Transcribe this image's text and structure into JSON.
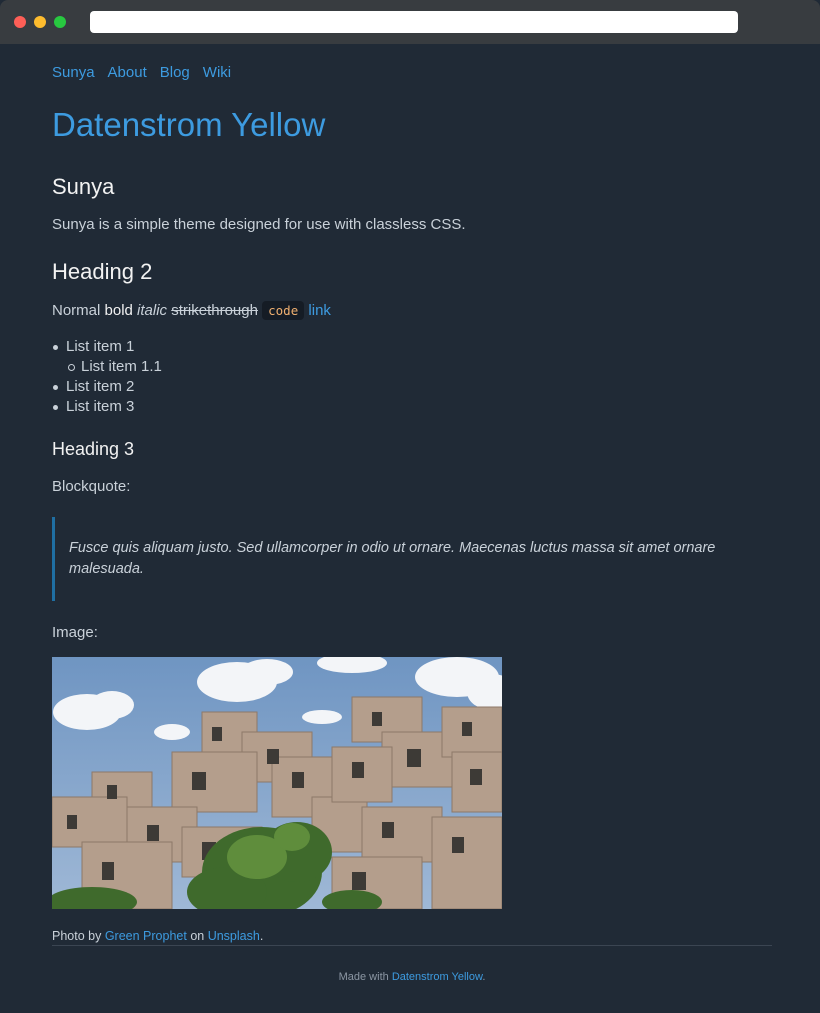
{
  "browser": {
    "url": ""
  },
  "nav": {
    "items": [
      "Sunya",
      "About",
      "Blog",
      "Wiki"
    ]
  },
  "site_title": "Datenstrom Yellow",
  "content": {
    "h1": "Sunya",
    "intro": "Sunya is a simple theme designed for use with classless CSS.",
    "h2": "Heading 2",
    "inline": {
      "normal": "Normal",
      "bold": "bold",
      "italic": "italic",
      "strike": "strikethrough",
      "code": "code",
      "link": "link"
    },
    "list": [
      "List item 1",
      "List item 1.1",
      "List item 2",
      "List item 3"
    ],
    "h3": "Heading 3",
    "blockquote_label": "Blockquote:",
    "blockquote": "Fusce quis aliquam justo. Sed ullamcorper in odio ut ornare. Maecenas luctus massa sit amet ornare malesuada.",
    "image_label": "Image:",
    "credit": {
      "prefix": "Photo by",
      "author": "Green Prophet",
      "middle": "on",
      "source": "Unsplash",
      "suffix": "."
    }
  },
  "footer": {
    "prefix": "Made with",
    "link": "Datenstrom Yellow",
    "suffix": "."
  },
  "colors": {
    "background": "#202a36",
    "accent": "#3d9be0",
    "chrome": "#383c40",
    "code": "#f0b070"
  }
}
